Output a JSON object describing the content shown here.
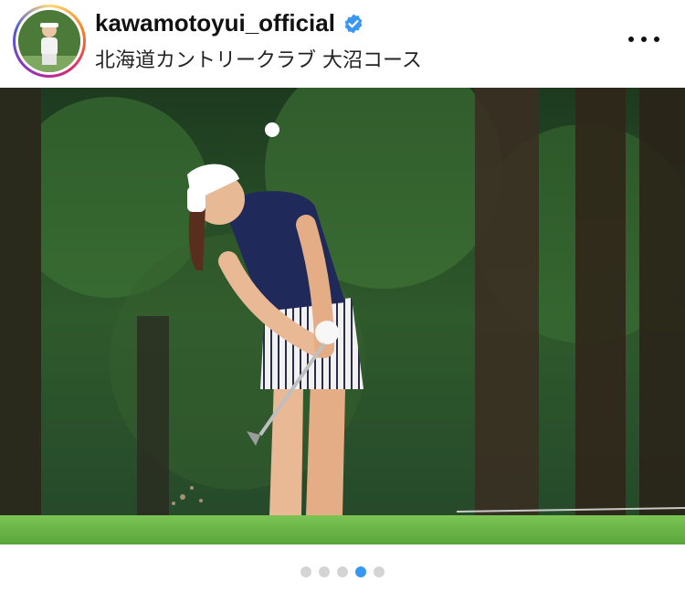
{
  "post": {
    "username": "kawamotoyui_official",
    "location": "北海道カントリークラブ 大沼コース",
    "verified": true
  },
  "carousel": {
    "total": 5,
    "active_index": 3
  },
  "icons": {
    "verified": "verified-badge-icon",
    "more": "more-options-icon"
  },
  "colors": {
    "verified_blue": "#3897f0",
    "active_dot": "#3897f0",
    "inactive_dot": "#d4d4d4"
  }
}
